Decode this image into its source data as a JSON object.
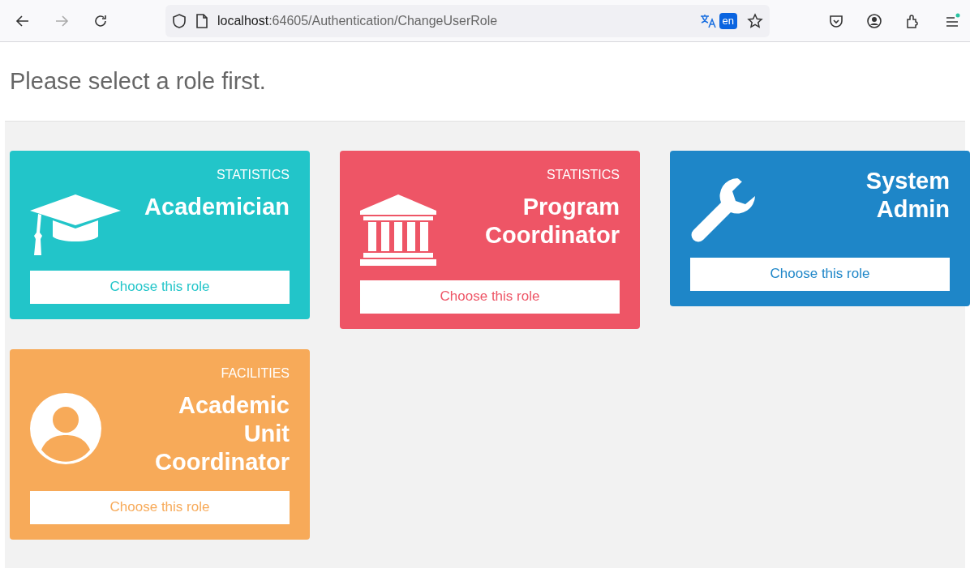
{
  "browser": {
    "url": "localhost:64605/Authentication/ChangeUserRole",
    "translate_badge": "en"
  },
  "heading": "Please select a role first.",
  "roles": [
    {
      "kind": "graduation",
      "color": "#22c5c9",
      "category": "STATISTICS",
      "name": "Academician",
      "button": "Choose this role"
    },
    {
      "kind": "building",
      "color": "#ee5566",
      "category": "STATISTICS",
      "name": "Program Coordinator",
      "button": "Choose this role"
    },
    {
      "kind": "wrench",
      "color": "#1e86c8",
      "name": "System Admin",
      "button": "Choose this role"
    },
    {
      "kind": "user",
      "color": "#f7aa59",
      "category": "FACILITIES",
      "name": "Academic Unit Coordinator",
      "button": "Choose this role"
    }
  ]
}
